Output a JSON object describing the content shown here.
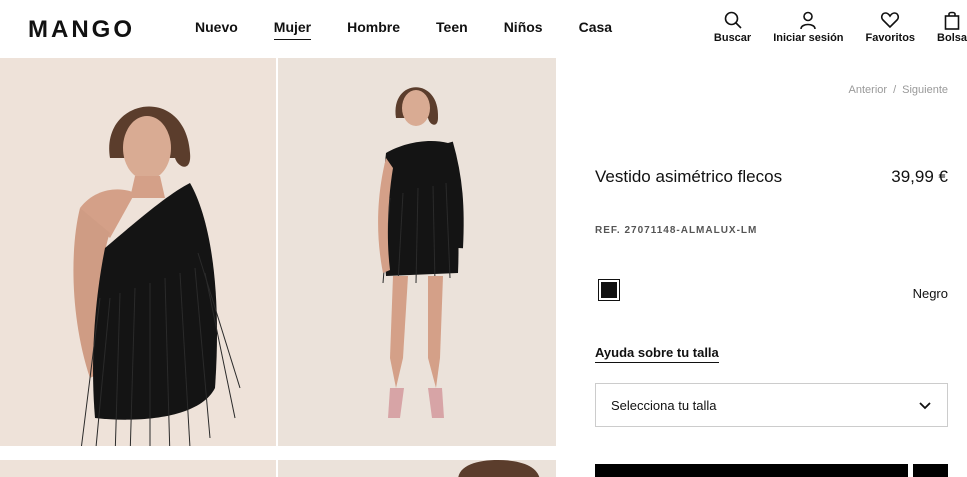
{
  "header": {
    "logo": "MANGO",
    "nav": [
      {
        "label": "Nuevo"
      },
      {
        "label": "Mujer",
        "active": true
      },
      {
        "label": "Hombre"
      },
      {
        "label": "Teen"
      },
      {
        "label": "Niños"
      },
      {
        "label": "Casa"
      }
    ],
    "actions": [
      {
        "label": "Buscar",
        "icon": "search-icon"
      },
      {
        "label": "Iniciar sesión",
        "icon": "user-icon"
      },
      {
        "label": "Favoritos",
        "icon": "heart-icon"
      },
      {
        "label": "Bolsa",
        "icon": "bag-icon"
      }
    ]
  },
  "gallery": {
    "background_color": "#eee2d9",
    "dress_color": "#111111"
  },
  "product": {
    "pager": {
      "prev": "Anterior",
      "separator": "/",
      "next": "Siguiente"
    },
    "title": "Vestido asimétrico flecos",
    "price": "39,99 €",
    "ref": "REF. 27071148-ALMALUX-LM",
    "color": {
      "name": "Negro",
      "swatch": "#111111"
    },
    "size_help": "Ayuda sobre tu talla",
    "size_select": {
      "placeholder": "Selecciona tu talla",
      "icon": "chevron-down-icon"
    }
  }
}
